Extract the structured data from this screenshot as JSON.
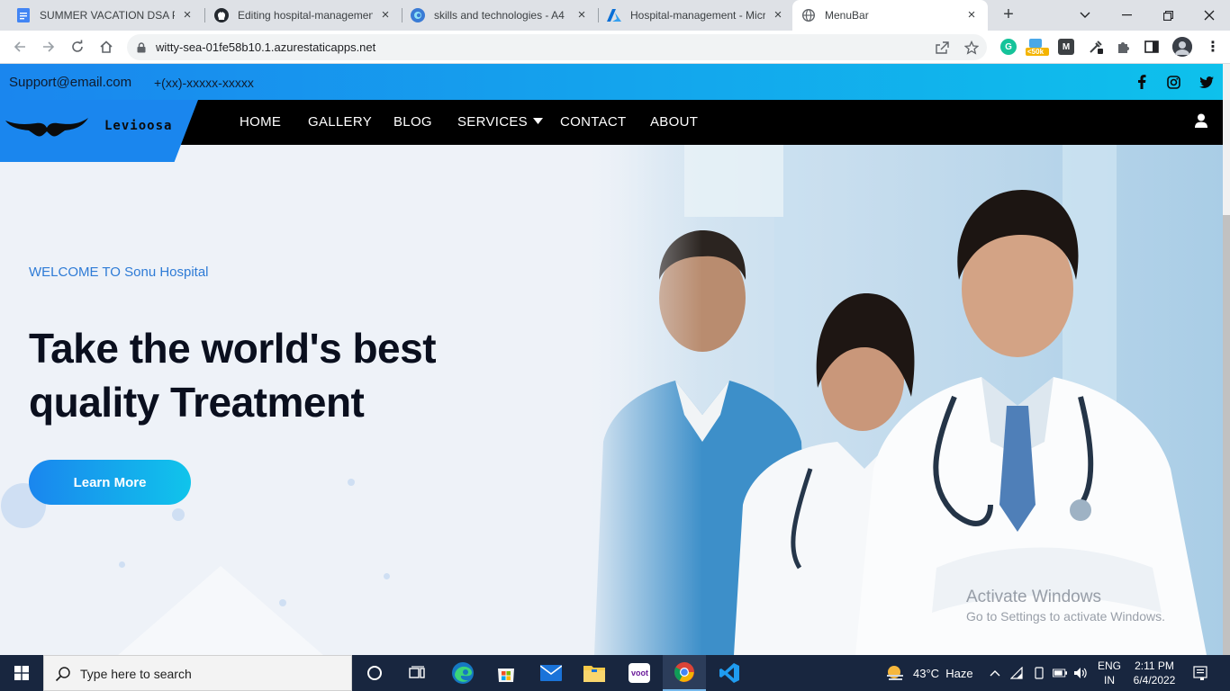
{
  "browser": {
    "tabs": [
      {
        "title": "SUMMER VACATION DSA PR",
        "icon": "google-docs-icon",
        "active": false
      },
      {
        "title": "Editing hospital-managemen",
        "icon": "github-icon",
        "active": false
      },
      {
        "title": "skills and technologies - A4",
        "icon": "edge-like-icon",
        "active": false
      },
      {
        "title": "Hospital-management - Micr",
        "icon": "azure-icon",
        "active": false
      },
      {
        "title": "MenuBar",
        "icon": "globe-icon",
        "active": true
      }
    ],
    "url": "witty-sea-01fe58b10.1.azurestaticapps.net",
    "extension_badge": "<50k"
  },
  "site": {
    "topbar": {
      "email": "Support@email.com",
      "phone": "+(xx)-xxxxx-xxxxx"
    },
    "brand": {
      "name": "Levioosa"
    },
    "nav": {
      "home": "HOME",
      "gallery": "GALLERY",
      "blog": "BLOG",
      "services": "SERVICES",
      "contact": "CONTACT",
      "about": "ABOUT"
    },
    "hero": {
      "welcome": "WELCOME TO Sonu Hospital",
      "headline_line1": "Take the world's best",
      "headline_line2": "quality Treatment",
      "cta": "Learn More"
    },
    "watermark": {
      "line1": "Activate Windows",
      "line2": "Go to Settings to activate Windows."
    }
  },
  "taskbar": {
    "search_placeholder": "Type here to search",
    "weather": "43°C  Haze",
    "lang_line1": "ENG",
    "lang_line2": "IN",
    "time": "2:11 PM",
    "date": "6/4/2022"
  },
  "colors": {
    "accent_blue": "#1a86ee",
    "accent_cyan": "#0ec1ec",
    "nav_black": "#000000",
    "welcome_blue": "#2e7bd6"
  }
}
